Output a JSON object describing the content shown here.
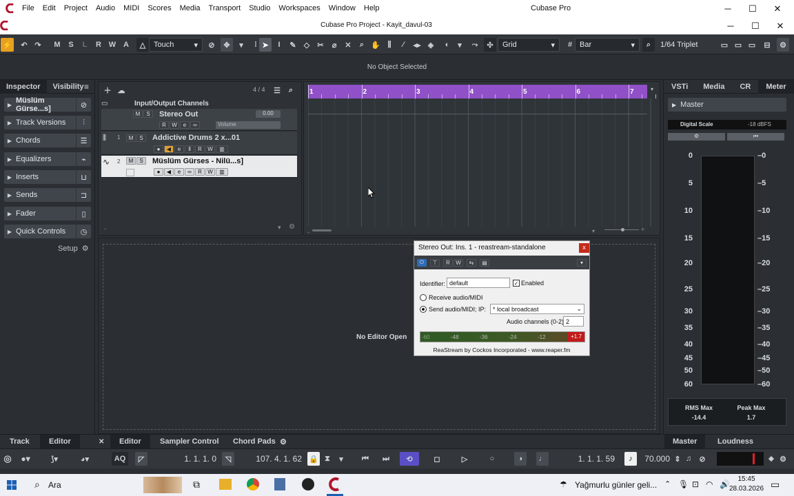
{
  "os": {
    "app_title": "Cubase Pro",
    "menu": [
      "File",
      "Edit",
      "Project",
      "Audio",
      "MIDI",
      "Scores",
      "Media",
      "Transport",
      "Studio",
      "Workspaces",
      "Window",
      "Help"
    ],
    "minimize": "─",
    "maximize": "☐",
    "close": "✕"
  },
  "project": {
    "title": "Cubase Pro Project - Kayit_davul-03"
  },
  "toolbar": {
    "undo": "↶",
    "redo": "↷",
    "modes": [
      "M",
      "S",
      "L",
      "R",
      "W",
      "A"
    ],
    "automation_mode": "Touch",
    "snap_type": "Grid",
    "grid_value": "Bar",
    "quantize": "1/64 Triplet"
  },
  "info_line": {
    "text": "No Object Selected"
  },
  "inspector": {
    "tabs": [
      "Inspector",
      "Visibility"
    ],
    "menu_icon": "≡",
    "sections": [
      {
        "label": "Müslüm Gürse...s]",
        "icon": "edit-icon"
      },
      {
        "label": "Track Versions",
        "icon": "versions-icon"
      },
      {
        "label": "Chords",
        "icon": "list-icon"
      },
      {
        "label": "Equalizers",
        "icon": "eq-icon"
      },
      {
        "label": "Inserts",
        "icon": "insert-icon"
      },
      {
        "label": "Sends",
        "icon": "send-icon"
      },
      {
        "label": "Fader",
        "icon": "fader-icon"
      },
      {
        "label": "Quick Controls",
        "icon": "qc-icon"
      }
    ],
    "setup": "Setup"
  },
  "tracklist": {
    "count": "4 / 4",
    "folder": "Input/Output Channels",
    "stereo_out": {
      "name": "Stereo Out",
      "value": "0.00",
      "param": "Volume"
    },
    "tracks": [
      {
        "num": "1",
        "name": "Addictive Drums 2 x...01"
      },
      {
        "num": "2",
        "name": "Müslüm Gürses - Nilü...s]"
      }
    ]
  },
  "ruler": {
    "bars": [
      "1",
      "2",
      "3",
      "4",
      "5",
      "6",
      "7"
    ]
  },
  "editor": {
    "no_editor": "No Editor Open"
  },
  "plugin": {
    "title": "Stereo Out: Ins. 1 - reastream-standalone",
    "close": "x",
    "identifier_label": "Identifier:",
    "identifier_value": "default",
    "enabled_label": "Enabled",
    "receive_label": "Receive audio/MIDI",
    "send_label": "Send audio/MIDI; IP:",
    "ip_value": "* local broadcast",
    "channels_label": "Audio channels (0-2):",
    "channels_value": "2",
    "meter_ticks": [
      "-60",
      "-48",
      "-36",
      "-24",
      "-12",
      "+1.7"
    ],
    "footer": "ReaStream by Cockos Incorporated - www.reaper.fm"
  },
  "rightzone": {
    "tabs": [
      "VSTi",
      "Media",
      "CR",
      "Meter"
    ],
    "master": "Master",
    "digital_scale": "Digital Scale",
    "dbfs": "-18 dBFS",
    "scale": [
      "0",
      "5",
      "10",
      "15",
      "20",
      "25",
      "30",
      "35",
      "40",
      "45",
      "50",
      "60"
    ],
    "rms_label": "RMS Max",
    "rms_value": "-14.4",
    "peak_label": "Peak Max",
    "peak_value": "1.7",
    "bottom_tabs": [
      "Master",
      "Loudness"
    ]
  },
  "bottom_tabs": {
    "left": [
      "Track",
      "Editor"
    ],
    "close": "✕",
    "right": [
      "Editor",
      "Sampler Control",
      "Chord Pads"
    ]
  },
  "transport": {
    "left_locator": "1. 1. 1. 0",
    "right_locator": "107. 4. 1. 62",
    "position": "1. 1. 1. 59",
    "tempo": "70.000",
    "aq": "AQ"
  },
  "taskbar": {
    "search": "Ara",
    "weather": "Yağmurlu günler geli...",
    "time": "15:45",
    "date": "28.03.2026"
  },
  "colors": {
    "accent": "#9050c8",
    "active_button": "#e8a020",
    "loop_active": "#5b4fc8"
  }
}
